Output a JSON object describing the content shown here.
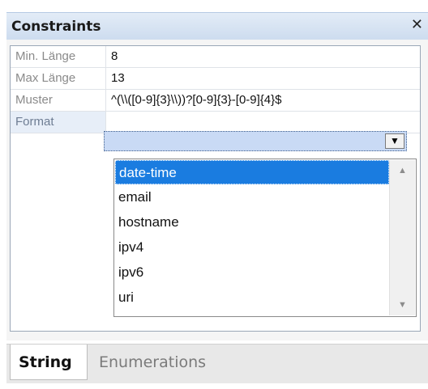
{
  "window": {
    "title": "Constraints",
    "close_glyph": "✕"
  },
  "properties": [
    {
      "label": "Min. Länge",
      "value": "8"
    },
    {
      "label": "Max Länge",
      "value": "13"
    },
    {
      "label": "Muster",
      "value": "^(\\\\([0-9]{3}\\\\))?[0-9]{3}-[0-9]{4}$"
    },
    {
      "label": "Format",
      "value": ""
    }
  ],
  "format_dropdown": {
    "selected": "date-time",
    "options": [
      "date-time",
      "email",
      "hostname",
      "ipv4",
      "ipv6",
      "uri"
    ],
    "arrow_glyph": "▼",
    "scroll_up_glyph": "▲",
    "scroll_down_glyph": "▼"
  },
  "tabs": [
    {
      "label": "String",
      "active": true
    },
    {
      "label": "Enumerations",
      "active": false
    }
  ]
}
